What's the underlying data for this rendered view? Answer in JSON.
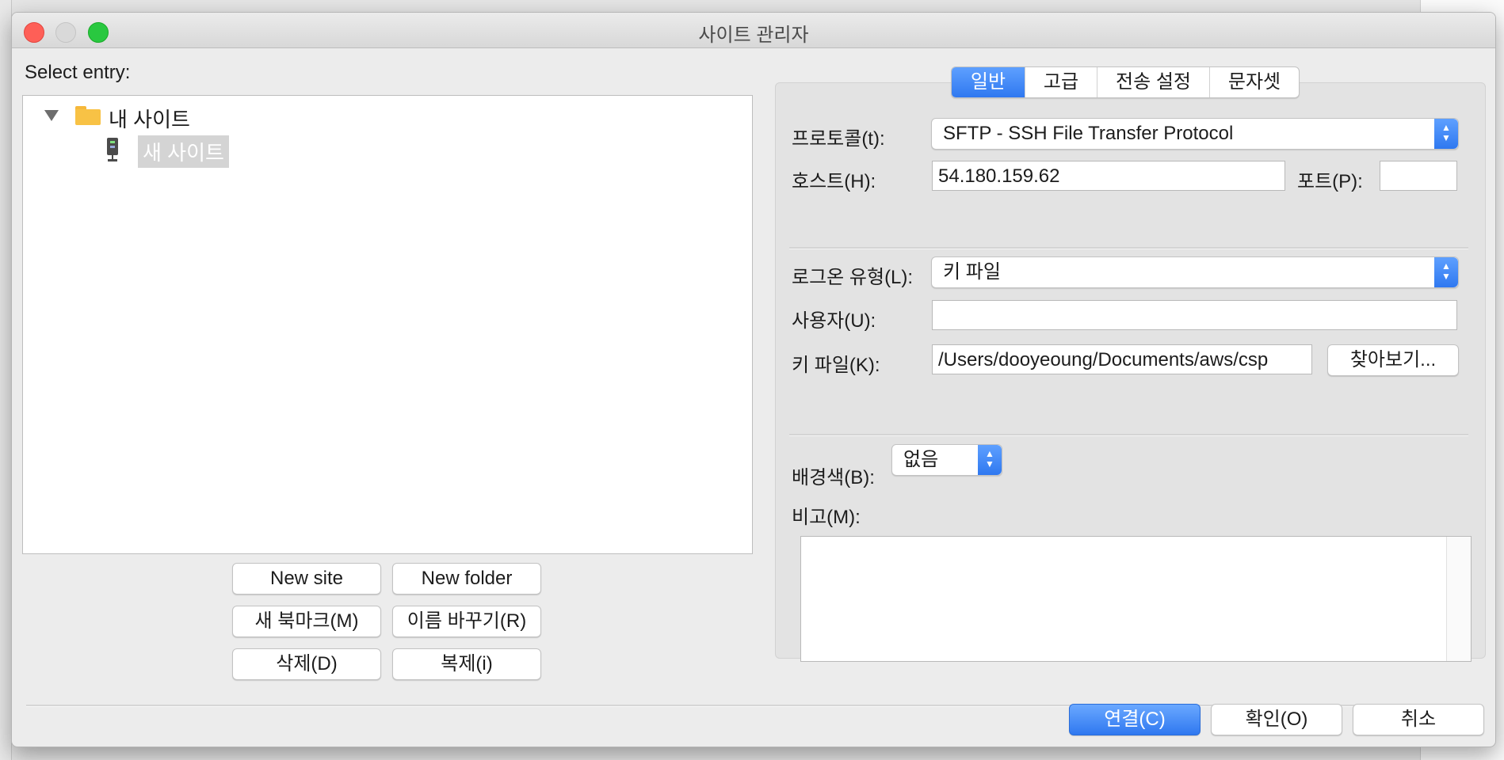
{
  "window": {
    "title": "사이트 관리자"
  },
  "left_pane": {
    "select_label": "Select entry:",
    "tree": {
      "root": {
        "label": "내 사이트",
        "icon": "folder-icon",
        "expanded": true
      },
      "children": [
        {
          "label": "새 사이트",
          "icon": "server-icon",
          "selected": true
        }
      ]
    },
    "buttons": {
      "new_site": "New site",
      "new_folder": "New folder",
      "new_bookmark": "새 북마크(M)",
      "rename": "이름 바꾸기(R)",
      "delete": "삭제(D)",
      "duplicate": "복제(i)"
    }
  },
  "tabs": [
    {
      "label": "일반",
      "active": true
    },
    {
      "label": "고급",
      "active": false
    },
    {
      "label": "전송 설정",
      "active": false
    },
    {
      "label": "문자셋",
      "active": false
    }
  ],
  "general": {
    "protocol_label": "프로토콜(t):",
    "protocol_value": "SFTP - SSH File Transfer Protocol",
    "host_label": "호스트(H):",
    "host_value": "54.180.159.62",
    "port_label": "포트(P):",
    "port_value": "",
    "logon_type_label": "로그온 유형(L):",
    "logon_type_value": "키 파일",
    "user_label": "사용자(U):",
    "user_value": "",
    "key_file_label": "키 파일(K):",
    "key_file_value": "/Users/dooyeoung/Documents/aws/csp",
    "browse_button": "찾아보기...",
    "bg_color_label": "배경색(B):",
    "bg_color_value": "없음",
    "comments_label": "비고(M):",
    "comments_value": ""
  },
  "footer": {
    "connect": "연결(C)",
    "ok": "확인(O)",
    "cancel": "취소"
  },
  "colors": {
    "accent": "#2f78f0",
    "selection": "#d4d4d4"
  }
}
